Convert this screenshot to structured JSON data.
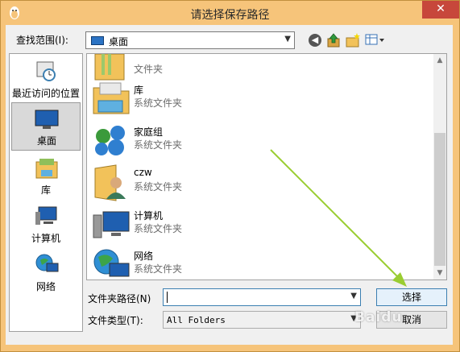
{
  "window": {
    "title": "请选择保存路径",
    "close_label": "✕"
  },
  "toolbar": {
    "lookin_label": "查找范围(I):",
    "lookin_value": "桌面",
    "icons": [
      "back-icon",
      "up-folder-icon",
      "new-folder-icon",
      "view-menu-icon"
    ]
  },
  "places": [
    {
      "label": "最近访问的位置",
      "icon": "recent-places-icon",
      "selected": false
    },
    {
      "label": "桌面",
      "icon": "desktop-icon",
      "selected": true
    },
    {
      "label": "库",
      "icon": "libraries-icon",
      "selected": false
    },
    {
      "label": "计算机",
      "icon": "computer-icon",
      "selected": false
    },
    {
      "label": "网络",
      "icon": "network-icon",
      "selected": false
    }
  ],
  "files": [
    {
      "name": "",
      "type": "文件夹",
      "icon": "folder-icon"
    },
    {
      "name": "库",
      "type": "系统文件夹",
      "icon": "libraries-icon"
    },
    {
      "name": "家庭组",
      "type": "系统文件夹",
      "icon": "homegroup-icon"
    },
    {
      "name": "czw",
      "type": "系统文件夹",
      "icon": "user-folder-icon"
    },
    {
      "name": "计算机",
      "type": "系统文件夹",
      "icon": "computer-icon"
    },
    {
      "name": "网络",
      "type": "系统文件夹",
      "icon": "network-icon"
    }
  ],
  "form": {
    "folder_path_label": "文件夹路径(N)",
    "folder_path_value": "",
    "file_type_label": "文件类型(T):",
    "file_type_value": "All Folders"
  },
  "buttons": {
    "ok": "选择",
    "cancel": "取消"
  },
  "watermark": "Baidu"
}
